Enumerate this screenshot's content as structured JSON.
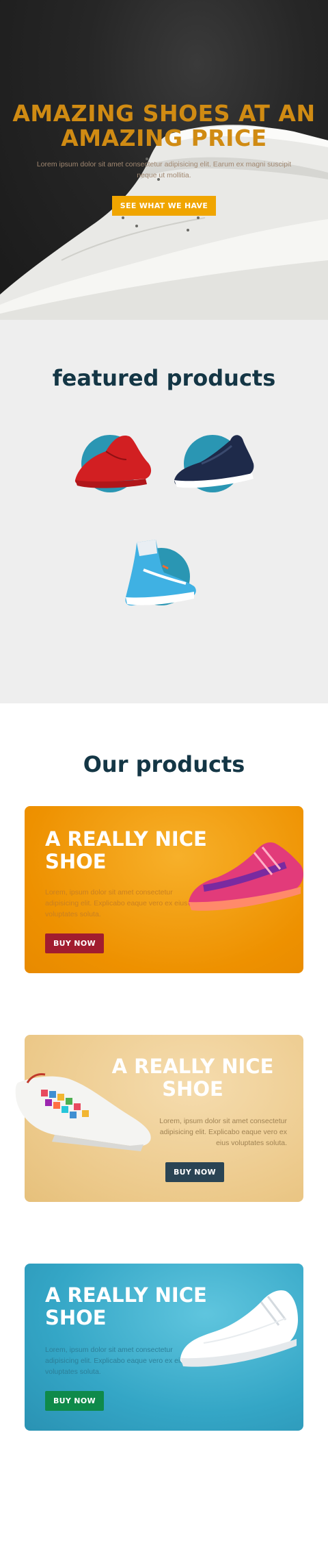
{
  "hero": {
    "title": "AMAZING SHOES AT AN AMAZING PRICE",
    "text": "Lorem ipsum dolor sit amet consectetur adipisicing elit. Earum ex magni suscipit neque ut mollitia.",
    "cta": "SEE WHAT WE HAVE"
  },
  "featured": {
    "title": "featured products",
    "items": [
      {
        "name": "red sneaker"
      },
      {
        "name": "navy running shoe"
      },
      {
        "name": "blue high-top"
      }
    ]
  },
  "ours": {
    "title": "Our products",
    "cards": [
      {
        "title": "A REALLY NICE SHOE",
        "text": "Lorem, ipsum dolor sit amet consectetur adipisicing elit. Explicabo eaque vero ex eius voluptates soluta.",
        "button": "BUY NOW",
        "button_color": "#a11d2f"
      },
      {
        "title": "A REALLY NICE SHOE",
        "text": "Lorem, ipsum dolor sit amet consectetur adipisicing elit. Explicabo eaque vero ex eius voluptates soluta.",
        "button": "BUY NOW",
        "button_color": "#2a4454"
      },
      {
        "title": "A REALLY NICE SHOE",
        "text": "Lorem, ipsum dolor sit amet consectetur adipisicing elit. Explicabo eaque vero ex eius voluptates soluta.",
        "button": "BUY NOW",
        "button_color": "#0f8a4a"
      }
    ]
  },
  "colors": {
    "accent": "#f0a500",
    "hero_title": "#d08b13",
    "heading": "#143645",
    "feature_circle": "#2a96b3"
  }
}
